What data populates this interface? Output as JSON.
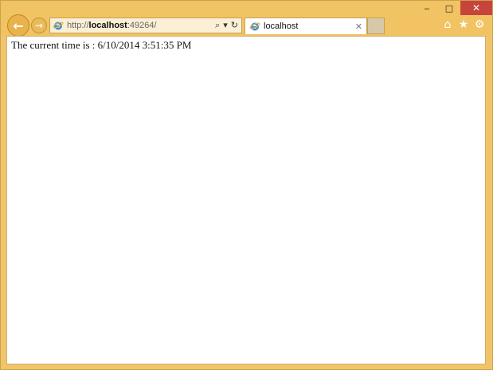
{
  "browser": {
    "url_prefix": "http://",
    "url_host": "localhost",
    "url_rest": ":49264/",
    "tab_title": "localhost",
    "window_controls": {
      "minimize": "‒",
      "maximize": "□",
      "close": "✕"
    },
    "icons": {
      "back": "←",
      "forward": "→",
      "search": "⌕",
      "dropdown": "▾",
      "refresh": "↻",
      "tab_close": "✕",
      "home": "⌂",
      "favorites": "★",
      "settings": "⚙"
    },
    "colors": {
      "frame": "#f1c363",
      "close_button": "#c7443a"
    }
  },
  "page": {
    "message": "The current time is : 6/10/2014 3:51:35 PM"
  }
}
